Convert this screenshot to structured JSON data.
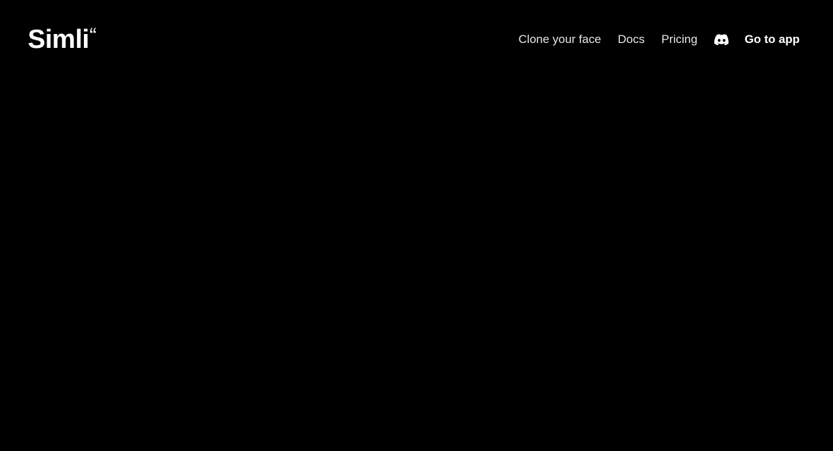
{
  "brand": {
    "name": "Simli",
    "quote_icon": "quote-mark-icon"
  },
  "nav": {
    "items": [
      {
        "label": "Clone your face"
      },
      {
        "label": "Docs"
      },
      {
        "label": "Pricing"
      }
    ],
    "discord_icon": "discord-icon",
    "cta_label": "Go to app"
  },
  "colors": {
    "background": "#000000",
    "text": "#ffffff",
    "nav_text": "#e6e6e6"
  }
}
